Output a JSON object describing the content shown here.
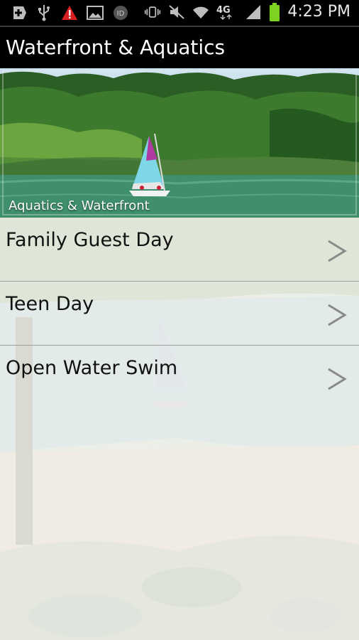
{
  "status_bar": {
    "time": "4:23 PM",
    "network": "4G",
    "icons_left": [
      "add-icon",
      "usb-icon",
      "warning-icon",
      "image-icon",
      "id-icon"
    ],
    "icons_right": [
      "vibrate-icon",
      "mute-icon",
      "wifi-icon",
      "network-4g-icon",
      "signal-icon",
      "battery-icon"
    ]
  },
  "header": {
    "title": "Waterfront & Aquatics"
  },
  "hero": {
    "caption": "Aquatics & Waterfront"
  },
  "list": {
    "items": [
      {
        "label": "Family Guest Day"
      },
      {
        "label": "Teen Day"
      },
      {
        "label": "Open Water Swim"
      }
    ]
  },
  "colors": {
    "status_bar_bg": "#000000",
    "title_bar_bg": "#000000",
    "battery": "#7ed321",
    "list_divider": "#9e9e9e",
    "chevron": "#8a8a8a"
  }
}
